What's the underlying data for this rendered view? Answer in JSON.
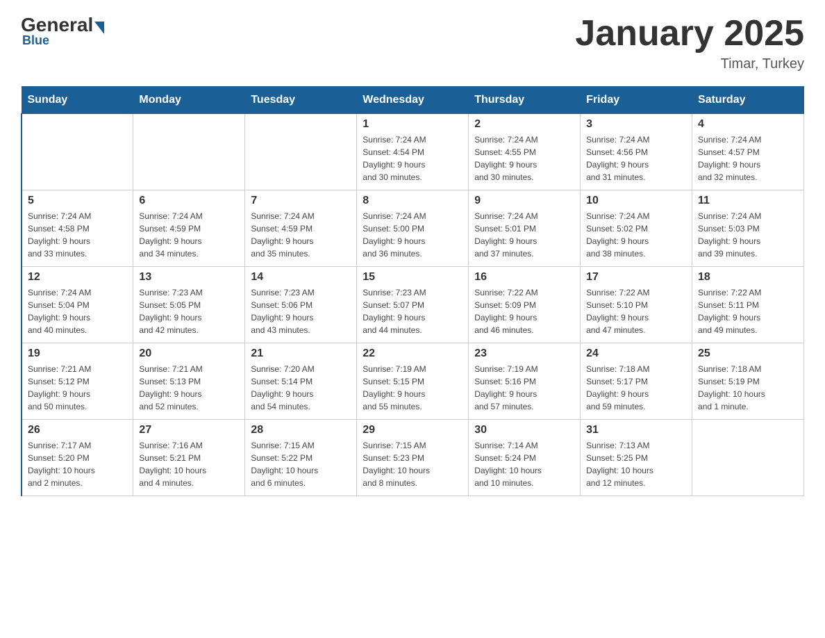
{
  "header": {
    "logo": {
      "general": "General",
      "blue": "Blue"
    },
    "title": "January 2025",
    "location": "Timar, Turkey"
  },
  "weekdays": [
    "Sunday",
    "Monday",
    "Tuesday",
    "Wednesday",
    "Thursday",
    "Friday",
    "Saturday"
  ],
  "weeks": [
    [
      {
        "date": "",
        "info": ""
      },
      {
        "date": "",
        "info": ""
      },
      {
        "date": "",
        "info": ""
      },
      {
        "date": "1",
        "info": "Sunrise: 7:24 AM\nSunset: 4:54 PM\nDaylight: 9 hours\nand 30 minutes."
      },
      {
        "date": "2",
        "info": "Sunrise: 7:24 AM\nSunset: 4:55 PM\nDaylight: 9 hours\nand 30 minutes."
      },
      {
        "date": "3",
        "info": "Sunrise: 7:24 AM\nSunset: 4:56 PM\nDaylight: 9 hours\nand 31 minutes."
      },
      {
        "date": "4",
        "info": "Sunrise: 7:24 AM\nSunset: 4:57 PM\nDaylight: 9 hours\nand 32 minutes."
      }
    ],
    [
      {
        "date": "5",
        "info": "Sunrise: 7:24 AM\nSunset: 4:58 PM\nDaylight: 9 hours\nand 33 minutes."
      },
      {
        "date": "6",
        "info": "Sunrise: 7:24 AM\nSunset: 4:59 PM\nDaylight: 9 hours\nand 34 minutes."
      },
      {
        "date": "7",
        "info": "Sunrise: 7:24 AM\nSunset: 4:59 PM\nDaylight: 9 hours\nand 35 minutes."
      },
      {
        "date": "8",
        "info": "Sunrise: 7:24 AM\nSunset: 5:00 PM\nDaylight: 9 hours\nand 36 minutes."
      },
      {
        "date": "9",
        "info": "Sunrise: 7:24 AM\nSunset: 5:01 PM\nDaylight: 9 hours\nand 37 minutes."
      },
      {
        "date": "10",
        "info": "Sunrise: 7:24 AM\nSunset: 5:02 PM\nDaylight: 9 hours\nand 38 minutes."
      },
      {
        "date": "11",
        "info": "Sunrise: 7:24 AM\nSunset: 5:03 PM\nDaylight: 9 hours\nand 39 minutes."
      }
    ],
    [
      {
        "date": "12",
        "info": "Sunrise: 7:24 AM\nSunset: 5:04 PM\nDaylight: 9 hours\nand 40 minutes."
      },
      {
        "date": "13",
        "info": "Sunrise: 7:23 AM\nSunset: 5:05 PM\nDaylight: 9 hours\nand 42 minutes."
      },
      {
        "date": "14",
        "info": "Sunrise: 7:23 AM\nSunset: 5:06 PM\nDaylight: 9 hours\nand 43 minutes."
      },
      {
        "date": "15",
        "info": "Sunrise: 7:23 AM\nSunset: 5:07 PM\nDaylight: 9 hours\nand 44 minutes."
      },
      {
        "date": "16",
        "info": "Sunrise: 7:22 AM\nSunset: 5:09 PM\nDaylight: 9 hours\nand 46 minutes."
      },
      {
        "date": "17",
        "info": "Sunrise: 7:22 AM\nSunset: 5:10 PM\nDaylight: 9 hours\nand 47 minutes."
      },
      {
        "date": "18",
        "info": "Sunrise: 7:22 AM\nSunset: 5:11 PM\nDaylight: 9 hours\nand 49 minutes."
      }
    ],
    [
      {
        "date": "19",
        "info": "Sunrise: 7:21 AM\nSunset: 5:12 PM\nDaylight: 9 hours\nand 50 minutes."
      },
      {
        "date": "20",
        "info": "Sunrise: 7:21 AM\nSunset: 5:13 PM\nDaylight: 9 hours\nand 52 minutes."
      },
      {
        "date": "21",
        "info": "Sunrise: 7:20 AM\nSunset: 5:14 PM\nDaylight: 9 hours\nand 54 minutes."
      },
      {
        "date": "22",
        "info": "Sunrise: 7:19 AM\nSunset: 5:15 PM\nDaylight: 9 hours\nand 55 minutes."
      },
      {
        "date": "23",
        "info": "Sunrise: 7:19 AM\nSunset: 5:16 PM\nDaylight: 9 hours\nand 57 minutes."
      },
      {
        "date": "24",
        "info": "Sunrise: 7:18 AM\nSunset: 5:17 PM\nDaylight: 9 hours\nand 59 minutes."
      },
      {
        "date": "25",
        "info": "Sunrise: 7:18 AM\nSunset: 5:19 PM\nDaylight: 10 hours\nand 1 minute."
      }
    ],
    [
      {
        "date": "26",
        "info": "Sunrise: 7:17 AM\nSunset: 5:20 PM\nDaylight: 10 hours\nand 2 minutes."
      },
      {
        "date": "27",
        "info": "Sunrise: 7:16 AM\nSunset: 5:21 PM\nDaylight: 10 hours\nand 4 minutes."
      },
      {
        "date": "28",
        "info": "Sunrise: 7:15 AM\nSunset: 5:22 PM\nDaylight: 10 hours\nand 6 minutes."
      },
      {
        "date": "29",
        "info": "Sunrise: 7:15 AM\nSunset: 5:23 PM\nDaylight: 10 hours\nand 8 minutes."
      },
      {
        "date": "30",
        "info": "Sunrise: 7:14 AM\nSunset: 5:24 PM\nDaylight: 10 hours\nand 10 minutes."
      },
      {
        "date": "31",
        "info": "Sunrise: 7:13 AM\nSunset: 5:25 PM\nDaylight: 10 hours\nand 12 minutes."
      },
      {
        "date": "",
        "info": ""
      }
    ]
  ]
}
